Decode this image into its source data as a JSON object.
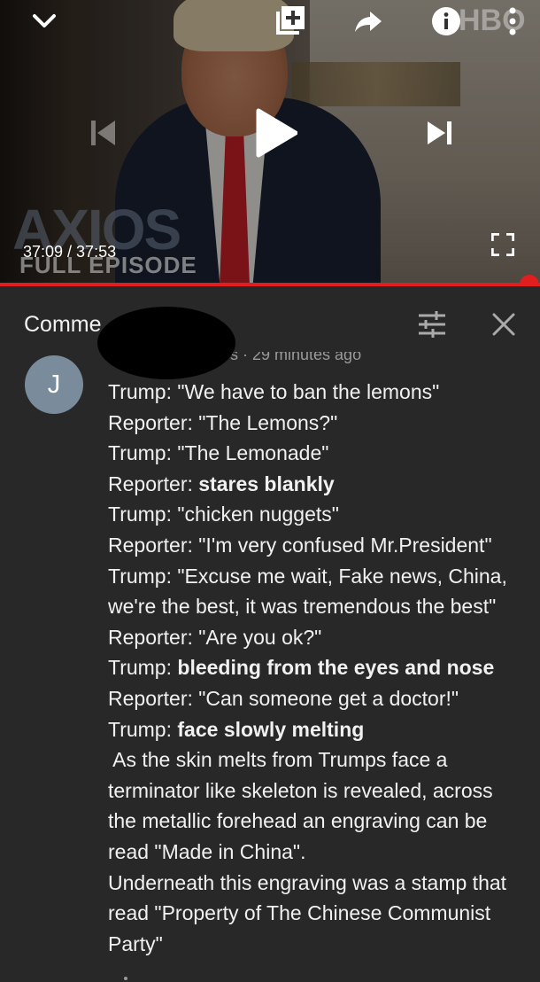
{
  "player": {
    "time_current": "37:09",
    "time_total": "37:53",
    "time_display": "37:09 / 37:53",
    "progress_fraction": 0.981,
    "watermark_axios": "AXIOS",
    "watermark_full_episode": "FULL EPISODE",
    "watermark_hbo": "HBO",
    "accent_color": "#e01e1e",
    "icons": [
      "chevron-down-icon",
      "add-to-playlist-icon",
      "share-icon",
      "info-icon",
      "more-vert-icon",
      "skip-previous-icon",
      "play-icon",
      "skip-next-icon",
      "fullscreen-icon"
    ]
  },
  "comments_panel": {
    "title": "Comme",
    "icons": [
      "sort-icon",
      "close-icon"
    ]
  },
  "comment": {
    "avatar_letter": "J",
    "avatar_color": "#7a8c9c",
    "meta": "s · 29 minutes ago",
    "lines": [
      {
        "a": "Trump: \"We have to ban the lemons\"",
        "b": ""
      },
      {
        "a": "Reporter: \"The Lemons?\"",
        "b": ""
      },
      {
        "a": "Trump: \"The Lemonade\"",
        "b": ""
      },
      {
        "a": "Reporter: ",
        "b": "stares blankly"
      },
      {
        "a": "Trump: \"chicken nuggets\"",
        "b": ""
      },
      {
        "a": "Reporter: \"I'm very confused Mr.President\"",
        "b": ""
      },
      {
        "a": "Trump: \"Excuse me wait, Fake news, China,",
        "b": ""
      },
      {
        "a": "we're the best, it was tremendous the best\"",
        "b": ""
      },
      {
        "a": "Reporter: \"Are you ok?\"",
        "b": ""
      },
      {
        "a": "Trump: ",
        "b": "bleeding from the eyes and nose"
      },
      {
        "a": "Reporter: \"Can someone get a doctor!\"",
        "b": ""
      },
      {
        "a": "Trump: ",
        "b": "face slowly melting"
      },
      {
        "a": " As the skin melts from Trumps face a",
        "b": ""
      },
      {
        "a": "terminator like skeleton is revealed, across",
        "b": ""
      },
      {
        "a": "the metallic forehead an engraving can be",
        "b": ""
      },
      {
        "a": "read \"Made in China\".",
        "b": ""
      },
      {
        "a": "Underneath this engraving was a stamp that",
        "b": ""
      },
      {
        "a": "read \"Property of The Chinese Communist",
        "b": ""
      },
      {
        "a": "Party\"",
        "b": ""
      }
    ]
  }
}
